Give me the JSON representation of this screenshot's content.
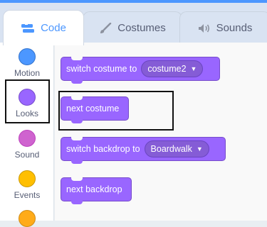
{
  "tabs": [
    {
      "label": "Code",
      "icon": "code-blocks-icon",
      "active": true
    },
    {
      "label": "Costumes",
      "icon": "paintbrush-icon",
      "active": false
    },
    {
      "label": "Sounds",
      "icon": "speaker-icon",
      "active": false
    }
  ],
  "categories": [
    {
      "label": "Motion",
      "color": "#4c97ff"
    },
    {
      "label": "Looks",
      "color": "#9966ff"
    },
    {
      "label": "Sound",
      "color": "#cf63cf"
    },
    {
      "label": "Events",
      "color": "#ffbf00"
    },
    {
      "label": "",
      "color": "#ffab19"
    }
  ],
  "blocks": {
    "switch_costume": {
      "text": "switch costume to",
      "dropdown": "costume2"
    },
    "next_costume": {
      "text": "next costume"
    },
    "switch_backdrop": {
      "text": "switch backdrop to",
      "dropdown": "Boardwalk"
    },
    "next_backdrop": {
      "text": "next backdrop"
    }
  },
  "colors": {
    "looks_block": "#9966ff",
    "accent": "#4c97ff",
    "highlight_box": "#111111"
  }
}
